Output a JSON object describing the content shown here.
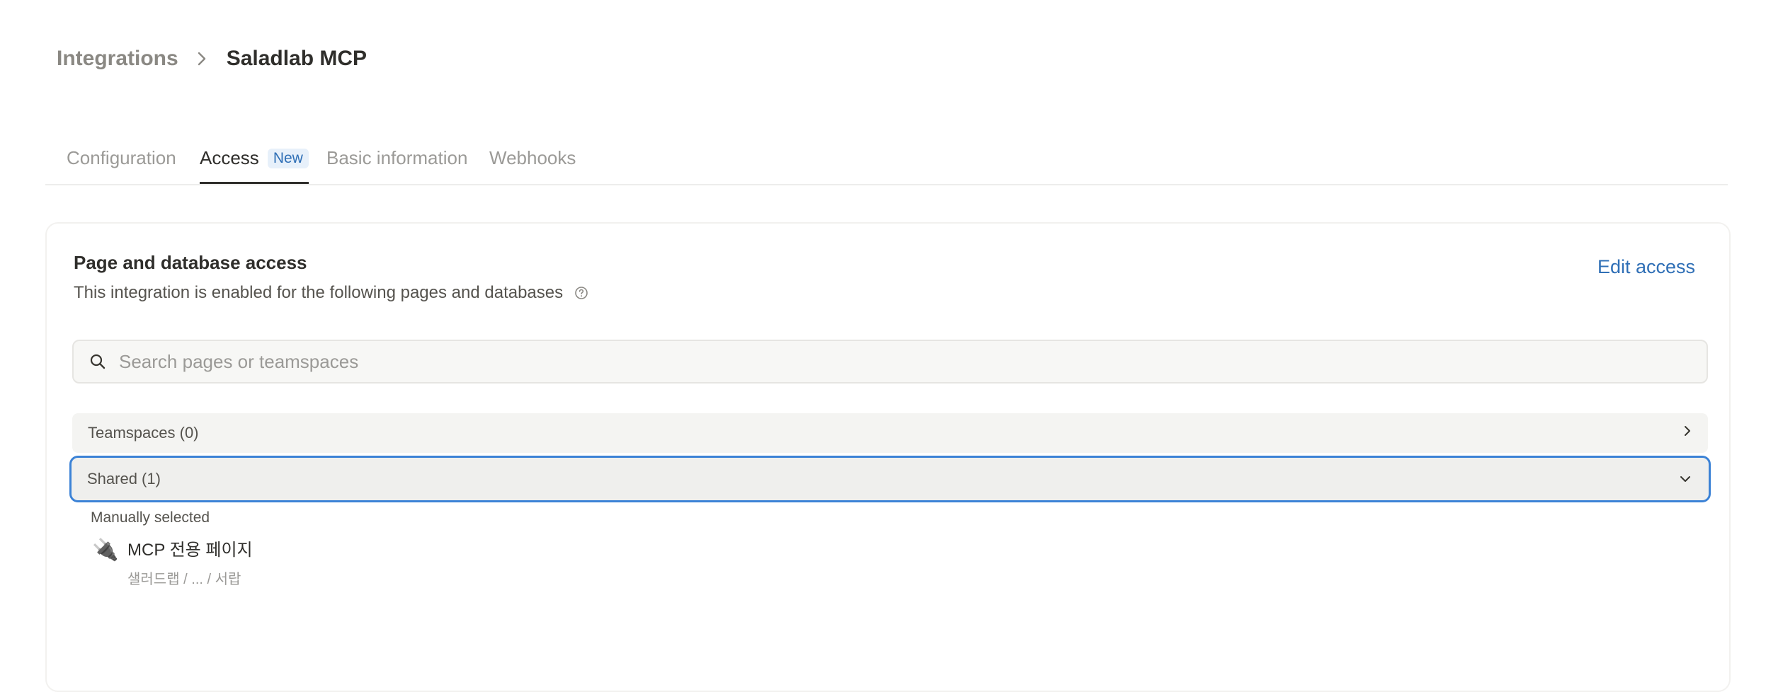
{
  "breadcrumb": {
    "parent": "Integrations",
    "current": "Saladlab MCP"
  },
  "tabs": [
    {
      "label": "Configuration"
    },
    {
      "label": "Access",
      "badge": "New",
      "active": true
    },
    {
      "label": "Basic information"
    },
    {
      "label": "Webhooks"
    }
  ],
  "access": {
    "title": "Page and database access",
    "subtitle": "This integration is enabled for the following pages and databases",
    "edit_label": "Edit access",
    "search_placeholder": "Search pages or teamspaces",
    "teamspaces_label": "Teamspaces (0)",
    "shared_label": "Shared (1)",
    "manual_label": "Manually selected",
    "page": {
      "icon": "🔌",
      "title": "MCP 전용 페이지",
      "path": "샐러드랩 / ... / 서랍"
    }
  },
  "colors": {
    "accent": "#2f6fb6",
    "focus_ring": "#3b82d6"
  },
  "icons": [
    "chevron-right-icon",
    "question-circle-icon",
    "search-icon",
    "chevron-down-icon",
    "plug-icon"
  ]
}
